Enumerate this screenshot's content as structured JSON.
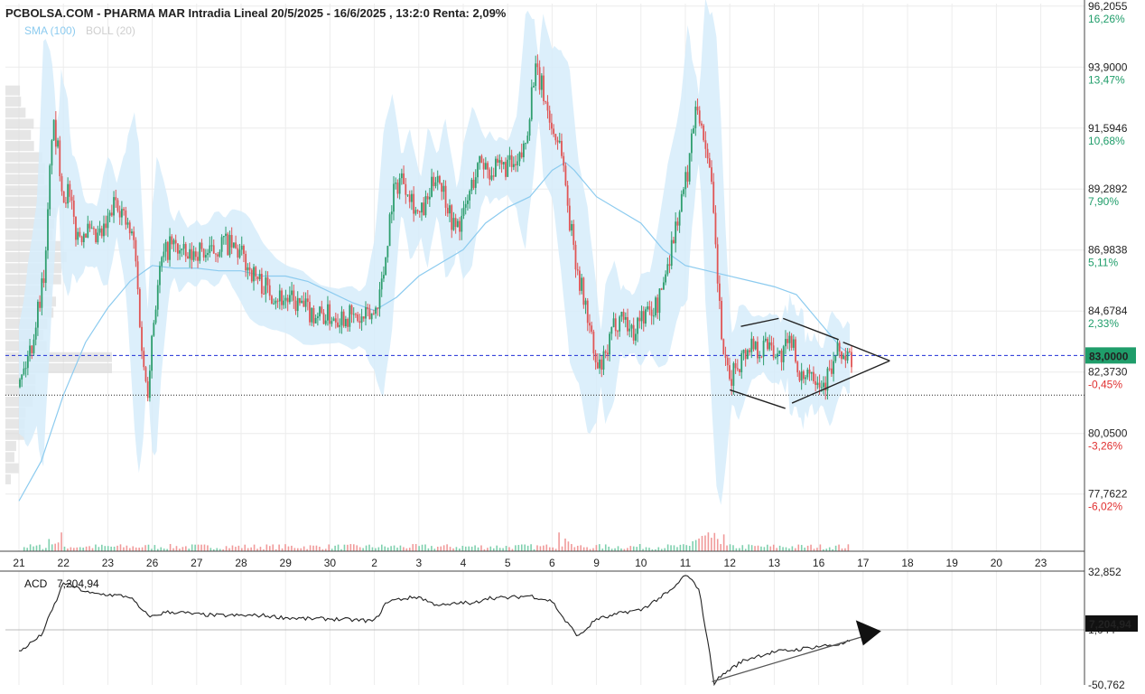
{
  "header": {
    "title": "PCBOLSA.COM - PHARMA MAR Intradia Lineal 20/5/2025 - 16/6/2025 , 13:2:0 Renta: 2,09%",
    "legend_sma": "SMA (100)",
    "legend_boll": "BOLL (20)"
  },
  "colors": {
    "up": "#2e9e6e",
    "down": "#e05555",
    "sma": "#8ccbef",
    "boll": "#d6ecfa",
    "ref_line": "#1f2fd6",
    "last_badge": "#1f9d6a",
    "pct_up": "#1f9d6a",
    "pct_down": "#e03030"
  },
  "chart_data": [
    {
      "type": "line",
      "name": "price",
      "y_ticks": [
        {
          "value": 96.2055,
          "label": "96,2055",
          "pct": "16,26%",
          "dir": "up"
        },
        {
          "value": 93.9,
          "label": "93,9000",
          "pct": "13,47%",
          "dir": "up"
        },
        {
          "value": 91.5946,
          "label": "91,5946",
          "pct": "10,68%",
          "dir": "up"
        },
        {
          "value": 89.2892,
          "label": "89,2892",
          "pct": "7,90%",
          "dir": "up"
        },
        {
          "value": 86.9838,
          "label": "86,9838",
          "pct": "5,11%",
          "dir": "up"
        },
        {
          "value": 84.6784,
          "label": "84,6784",
          "pct": "2,33%",
          "dir": "up"
        },
        {
          "value": 82.373,
          "label": "82,3730",
          "pct": "-0,45%",
          "dir": "down"
        },
        {
          "value": 80.05,
          "label": "80,0500",
          "pct": "-3,26%",
          "dir": "down"
        },
        {
          "value": 77.7622,
          "label": "77,7622",
          "pct": "-6,02%",
          "dir": "down"
        }
      ],
      "ylim": [
        75.6,
        96.3
      ],
      "x_ticks": [
        "21",
        "22",
        "23",
        "26",
        "27",
        "28",
        "29",
        "30",
        "2",
        "3",
        "4",
        "5",
        "6",
        "9",
        "10",
        "11",
        "12",
        "13",
        "16",
        "17",
        "18",
        "19",
        "20",
        "23"
      ],
      "last_price": {
        "value": 83.0,
        "label": "83,0000"
      },
      "ref_level": 83.0,
      "support_level": 81.5,
      "price_path": [
        [
          0,
          81.8
        ],
        [
          0.3,
          83.5
        ],
        [
          0.6,
          86.5
        ],
        [
          0.75,
          91.8
        ],
        [
          0.9,
          90.5
        ],
        [
          1.0,
          89.0
        ],
        [
          1.1,
          89.2
        ],
        [
          1.3,
          87.5
        ],
        [
          1.5,
          87.8
        ],
        [
          1.7,
          87.3
        ],
        [
          1.9,
          87.6
        ],
        [
          2.0,
          88.0
        ],
        [
          2.2,
          89.0
        ],
        [
          2.4,
          88.0
        ],
        [
          2.6,
          87.2
        ],
        [
          2.8,
          82.5
        ],
        [
          2.9,
          81.8
        ],
        [
          3.0,
          84.0
        ],
        [
          3.2,
          86.5
        ],
        [
          3.4,
          87.2
        ],
        [
          3.6,
          87.0
        ],
        [
          3.8,
          86.6
        ],
        [
          4.0,
          87.0
        ],
        [
          4.3,
          86.8
        ],
        [
          4.6,
          87.3
        ],
        [
          5.0,
          86.8
        ],
        [
          5.3,
          86.0
        ],
        [
          5.6,
          85.5
        ],
        [
          5.9,
          85.2
        ],
        [
          6.2,
          85.0
        ],
        [
          6.6,
          84.6
        ],
        [
          7.0,
          84.5
        ],
        [
          7.4,
          84.5
        ],
        [
          7.7,
          84.3
        ],
        [
          8.0,
          84.6
        ],
        [
          8.2,
          86.0
        ],
        [
          8.4,
          89.0
        ],
        [
          8.6,
          89.8
        ],
        [
          8.8,
          89.2
        ],
        [
          9.0,
          88.2
        ],
        [
          9.2,
          88.8
        ],
        [
          9.4,
          90.0
        ],
        [
          9.6,
          89.0
        ],
        [
          9.8,
          87.8
        ],
        [
          10.0,
          88.2
        ],
        [
          10.2,
          89.5
        ],
        [
          10.4,
          90.4
        ],
        [
          10.6,
          90.0
        ],
        [
          10.8,
          90.0
        ],
        [
          11.0,
          90.2
        ],
        [
          11.2,
          90.0
        ],
        [
          11.4,
          91.0
        ],
        [
          11.6,
          93.8
        ],
        [
          11.8,
          93.0
        ],
        [
          12.0,
          91.5
        ],
        [
          12.2,
          91.0
        ],
        [
          12.4,
          88.0
        ],
        [
          12.6,
          86.0
        ],
        [
          12.8,
          84.5
        ],
        [
          13.0,
          82.4
        ],
        [
          13.2,
          82.8
        ],
        [
          13.4,
          84.2
        ],
        [
          13.6,
          84.6
        ],
        [
          13.8,
          83.8
        ],
        [
          14.0,
          84.5
        ],
        [
          14.2,
          84.6
        ],
        [
          14.4,
          85.0
        ],
        [
          14.6,
          86.5
        ],
        [
          14.8,
          88.0
        ],
        [
          15.0,
          89.5
        ],
        [
          15.1,
          90.5
        ],
        [
          15.25,
          93.0
        ],
        [
          15.35,
          91.5
        ],
        [
          15.5,
          90.8
        ],
        [
          15.6,
          89.0
        ],
        [
          15.7,
          86.5
        ],
        [
          15.8,
          84.0
        ],
        [
          15.9,
          82.5
        ],
        [
          16.0,
          82.0
        ],
        [
          16.1,
          82.5
        ],
        [
          16.3,
          83.0
        ],
        [
          16.5,
          83.5
        ],
        [
          16.7,
          83.2
        ],
        [
          16.9,
          83.6
        ],
        [
          17.1,
          82.9
        ],
        [
          17.3,
          83.3
        ],
        [
          17.45,
          83.8
        ],
        [
          17.55,
          81.6
        ],
        [
          17.7,
          82.5
        ],
        [
          17.9,
          82.4
        ],
        [
          18.1,
          81.9
        ],
        [
          18.3,
          82.5
        ],
        [
          18.45,
          83.2
        ],
        [
          18.6,
          82.9
        ],
        [
          18.75,
          82.8
        ]
      ],
      "sma_path": [
        [
          0,
          77.5
        ],
        [
          0.5,
          79.0
        ],
        [
          1.0,
          81.5
        ],
        [
          1.5,
          83.5
        ],
        [
          2.0,
          84.8
        ],
        [
          2.5,
          85.8
        ],
        [
          3.0,
          86.4
        ],
        [
          3.5,
          86.3
        ],
        [
          4.0,
          86.3
        ],
        [
          4.5,
          86.2
        ],
        [
          5.0,
          86.2
        ],
        [
          5.5,
          86.0
        ],
        [
          6.0,
          86.0
        ],
        [
          6.5,
          85.8
        ],
        [
          7.0,
          85.4
        ],
        [
          7.5,
          85.0
        ],
        [
          8.0,
          84.7
        ],
        [
          8.5,
          85.2
        ],
        [
          9.0,
          86.0
        ],
        [
          9.5,
          86.5
        ],
        [
          10.0,
          87.0
        ],
        [
          10.5,
          88.0
        ],
        [
          11.0,
          88.6
        ],
        [
          11.5,
          89.0
        ],
        [
          12.0,
          90.0
        ],
        [
          12.3,
          90.3
        ],
        [
          12.5,
          90.0
        ],
        [
          13.0,
          89.0
        ],
        [
          13.5,
          88.5
        ],
        [
          14.0,
          88.0
        ],
        [
          14.5,
          87.0
        ],
        [
          15.0,
          86.4
        ],
        [
          15.5,
          86.2
        ],
        [
          16.0,
          86.0
        ],
        [
          16.5,
          85.8
        ],
        [
          17.0,
          85.6
        ],
        [
          17.5,
          85.3
        ],
        [
          17.9,
          84.5
        ],
        [
          18.2,
          83.9
        ],
        [
          18.5,
          83.3
        ],
        [
          18.75,
          83.0
        ]
      ],
      "boll_width": 1.7,
      "patterns": {
        "triangle_upper": [
          [
            16.25,
            84.1
          ],
          [
            17.1,
            84.4
          ],
          [
            17.2,
            84.4
          ],
          [
            18.45,
            83.6
          ],
          [
            18.55,
            83.5
          ],
          [
            19.5,
            82.8
          ],
          [
            19.6,
            82.8
          ]
        ],
        "triangle_lower": [
          [
            16.0,
            81.7
          ],
          [
            17.25,
            81.0
          ],
          [
            17.4,
            81.2
          ],
          [
            18.0,
            81.5
          ],
          [
            19.6,
            82.8
          ]
        ]
      }
    },
    {
      "type": "line",
      "name": "ACD",
      "label": "ACD",
      "value_label": "7,204,94",
      "badge_label": "7,204,94",
      "y_ticks_partial": [
        "32,852",
        "1,044",
        "-50,762"
      ],
      "path": [
        [
          0,
          0.3
        ],
        [
          0.5,
          0.45
        ],
        [
          0.9,
          0.82
        ],
        [
          1.0,
          0.93
        ],
        [
          1.3,
          0.88
        ],
        [
          1.6,
          0.83
        ],
        [
          2.0,
          0.82
        ],
        [
          2.5,
          0.8
        ],
        [
          2.8,
          0.66
        ],
        [
          3.0,
          0.62
        ],
        [
          3.3,
          0.66
        ],
        [
          3.6,
          0.66
        ],
        [
          4.0,
          0.64
        ],
        [
          4.5,
          0.63
        ],
        [
          5.0,
          0.63
        ],
        [
          5.5,
          0.63
        ],
        [
          6.0,
          0.61
        ],
        [
          6.5,
          0.6
        ],
        [
          7.0,
          0.6
        ],
        [
          7.5,
          0.59
        ],
        [
          8.0,
          0.58
        ],
        [
          8.3,
          0.76
        ],
        [
          8.6,
          0.78
        ],
        [
          9.0,
          0.8
        ],
        [
          9.3,
          0.74
        ],
        [
          9.6,
          0.72
        ],
        [
          10.0,
          0.75
        ],
        [
          10.2,
          0.73
        ],
        [
          10.5,
          0.79
        ],
        [
          11.0,
          0.79
        ],
        [
          11.5,
          0.81
        ],
        [
          12.0,
          0.76
        ],
        [
          12.3,
          0.58
        ],
        [
          12.6,
          0.44
        ],
        [
          12.8,
          0.52
        ],
        [
          13.0,
          0.6
        ],
        [
          13.3,
          0.62
        ],
        [
          13.6,
          0.66
        ],
        [
          14.0,
          0.68
        ],
        [
          14.3,
          0.76
        ],
        [
          14.7,
          0.86
        ],
        [
          15.0,
          1.0
        ],
        [
          15.3,
          0.88
        ],
        [
          15.5,
          0.4
        ],
        [
          15.65,
          0.02
        ],
        [
          15.8,
          0.08
        ],
        [
          16.0,
          0.14
        ],
        [
          16.3,
          0.22
        ],
        [
          16.6,
          0.26
        ],
        [
          17.0,
          0.3
        ],
        [
          17.5,
          0.32
        ],
        [
          18.0,
          0.35
        ],
        [
          18.5,
          0.37
        ],
        [
          18.75,
          0.4
        ]
      ],
      "trend_arrow": [
        [
          15.6,
          0.03
        ],
        [
          19.0,
          0.44
        ]
      ]
    }
  ]
}
